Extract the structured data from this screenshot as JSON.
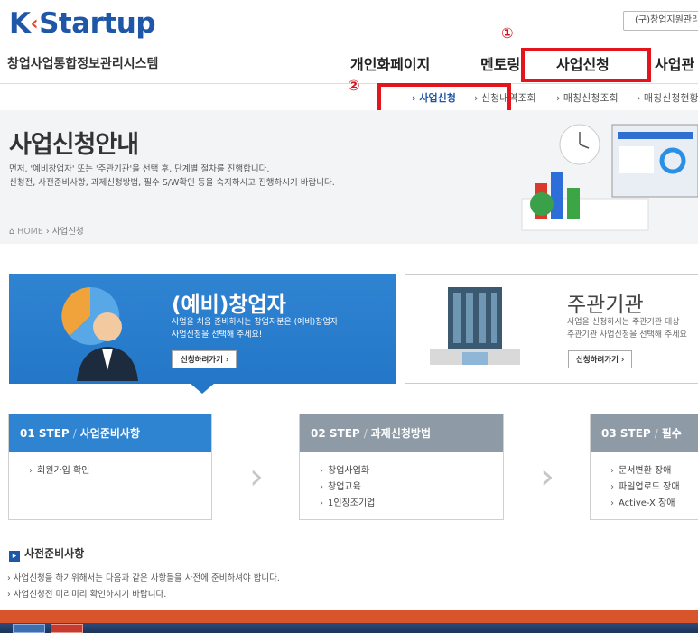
{
  "header": {
    "logo_text": "Startup",
    "logo_prefix": "K",
    "old_site_label": "(구)창업지원관리",
    "system_title": "창업사업통합정보관리시스템",
    "gnb": [
      "개인화페이지",
      "멘토링",
      "사업신청",
      "사업관"
    ],
    "sub_nav": [
      "› 사업신청",
      "› 신청내역조회",
      "› 매칭신청조회",
      "› 매칭신청현황"
    ]
  },
  "annotations": {
    "circle1": "①",
    "circle2": "②"
  },
  "hero": {
    "title": "사업신청안내",
    "desc_line1": "먼저, '예비창업자' 또는 '주관기관'을 선택 후, 단계별 절차를 진행합니다.",
    "desc_line2": "신청전, 사전준비사항, 과제신청방법, 필수 S/W확인 등을 숙지하시고 진행하시기 바랍니다.",
    "crumb_home": "HOME",
    "crumb_current": "사업신청"
  },
  "choices": {
    "entrepreneur": {
      "title": "(예비)창업자",
      "desc1": "사업을 처음 준비하시는 창업자분은 (예비)창업자",
      "desc2": "사업신청을 선택해 주세요!",
      "button": "신청하려가기 ›"
    },
    "organization": {
      "title": "주관기관",
      "desc1": "사업을 신청하시는 주관기관 대상",
      "desc2": "주관기관 사업신청을 선택해 주세요",
      "button": "신청하려가기 ›"
    }
  },
  "steps": [
    {
      "num": "01 STEP",
      "title": "사업준비사항",
      "items": [
        "회원가입 확인"
      ]
    },
    {
      "num": "02 STEP",
      "title": "과제신청방법",
      "items": [
        "창업사업화",
        "창업교육",
        "1인창조기업"
      ]
    },
    {
      "num": "03 STEP",
      "title": "필수",
      "items": [
        "문서변환 장애",
        "파일업로드 장애",
        "Active-X 장애"
      ]
    }
  ],
  "prep": {
    "title": "사전준비사항",
    "line1": "› 사업신청을 하기위해서는 다음과 같은 사항들을 사전에 준비하셔야 합니다.",
    "line2": "› 사업신청전 미리미리 확인하시기 바랍니다."
  },
  "colors": {
    "brand": "#1f57a8",
    "step_active": "#2f84d2",
    "step_inactive": "#8e9aa6",
    "highlight": "#e4141c"
  }
}
